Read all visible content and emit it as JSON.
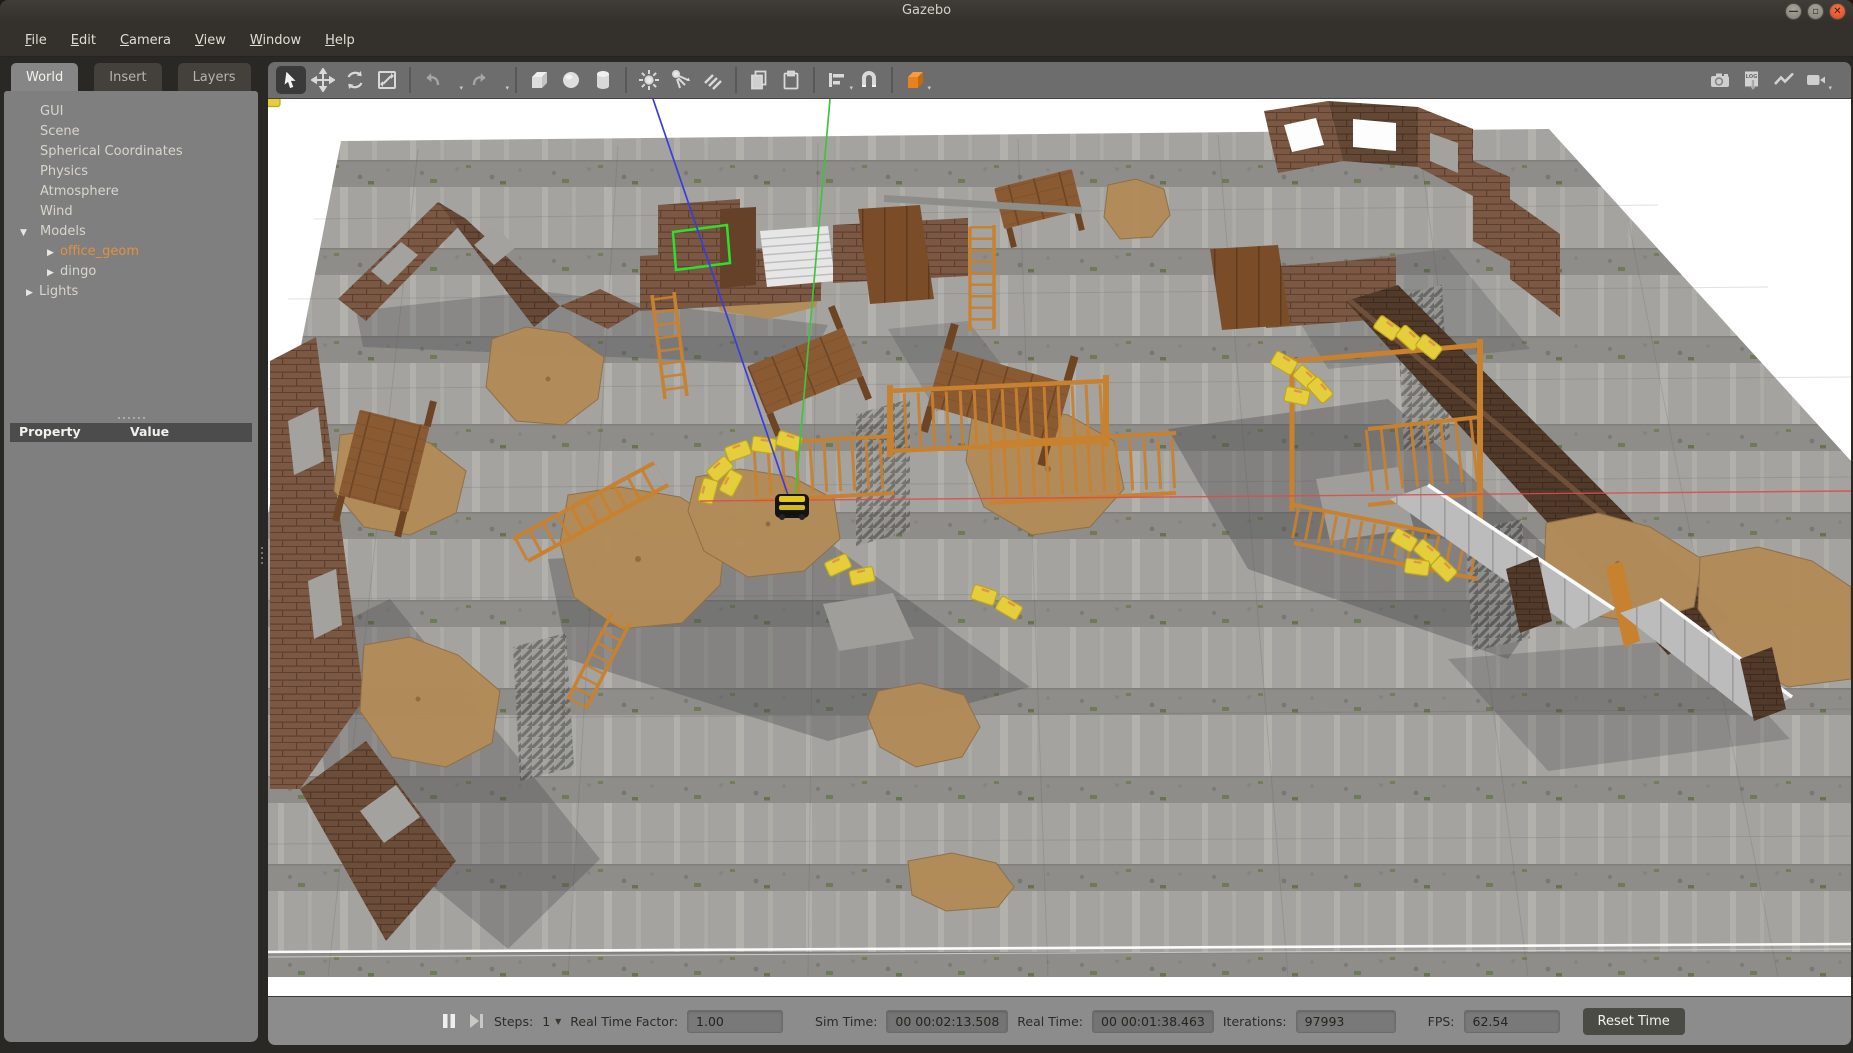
{
  "window": {
    "title": "Gazebo"
  },
  "menubar": {
    "items": [
      {
        "label": "File"
      },
      {
        "label": "Edit"
      },
      {
        "label": "Camera"
      },
      {
        "label": "View"
      },
      {
        "label": "Window"
      },
      {
        "label": "Help"
      }
    ]
  },
  "panel": {
    "tabs": [
      {
        "label": "World"
      },
      {
        "label": "Insert"
      },
      {
        "label": "Layers"
      }
    ],
    "tree": [
      {
        "label": "GUI",
        "arrow": ""
      },
      {
        "label": "Scene",
        "arrow": ""
      },
      {
        "label": "Spherical Coordinates",
        "arrow": ""
      },
      {
        "label": "Physics",
        "arrow": ""
      },
      {
        "label": "Atmosphere",
        "arrow": ""
      },
      {
        "label": "Wind",
        "arrow": ""
      },
      {
        "label": "Models",
        "arrow": "▼"
      },
      {
        "label": "office_geom",
        "arrow": "▶"
      },
      {
        "label": "dingo",
        "arrow": "▶"
      },
      {
        "label": "Lights",
        "arrow": "▶"
      }
    ],
    "property_header": {
      "property": "Property",
      "value": "Value"
    }
  },
  "toolbar": {
    "icons": [
      "select-tool",
      "translate-tool",
      "rotate-tool",
      "scale-tool",
      "undo",
      "undo-history",
      "redo",
      "redo-history",
      "insert-box",
      "insert-sphere",
      "insert-cylinder",
      "point-light",
      "spot-light",
      "directional-light",
      "copy",
      "paste",
      "align",
      "snap",
      "view-angle"
    ],
    "right_icons": [
      "screenshot",
      "log-record",
      "plot",
      "video-record"
    ],
    "log_text": "LOG"
  },
  "statusbar": {
    "steps_label": "Steps:",
    "steps_value": "1",
    "rtf_label": "Real Time Factor:",
    "rtf_value": "1.00",
    "sim_time_label": "Sim Time:",
    "sim_time_value": "00 00:02:13.508",
    "real_time_label": "Real Time:",
    "real_time_value": "00 00:01:38.463",
    "iterations_label": "Iterations:",
    "iterations_value": "97993",
    "fps_label": "FPS:",
    "fps_value": "62.54",
    "reset_label": "Reset Time"
  },
  "scene": {
    "selected_model": "office_geom",
    "colors": {
      "selection_box": "#2ce02c",
      "axis_z": "#3b3be0",
      "axis_y": "#3fc43f",
      "axis_x": "#d65050",
      "accent_orange": "#e0913d"
    }
  }
}
